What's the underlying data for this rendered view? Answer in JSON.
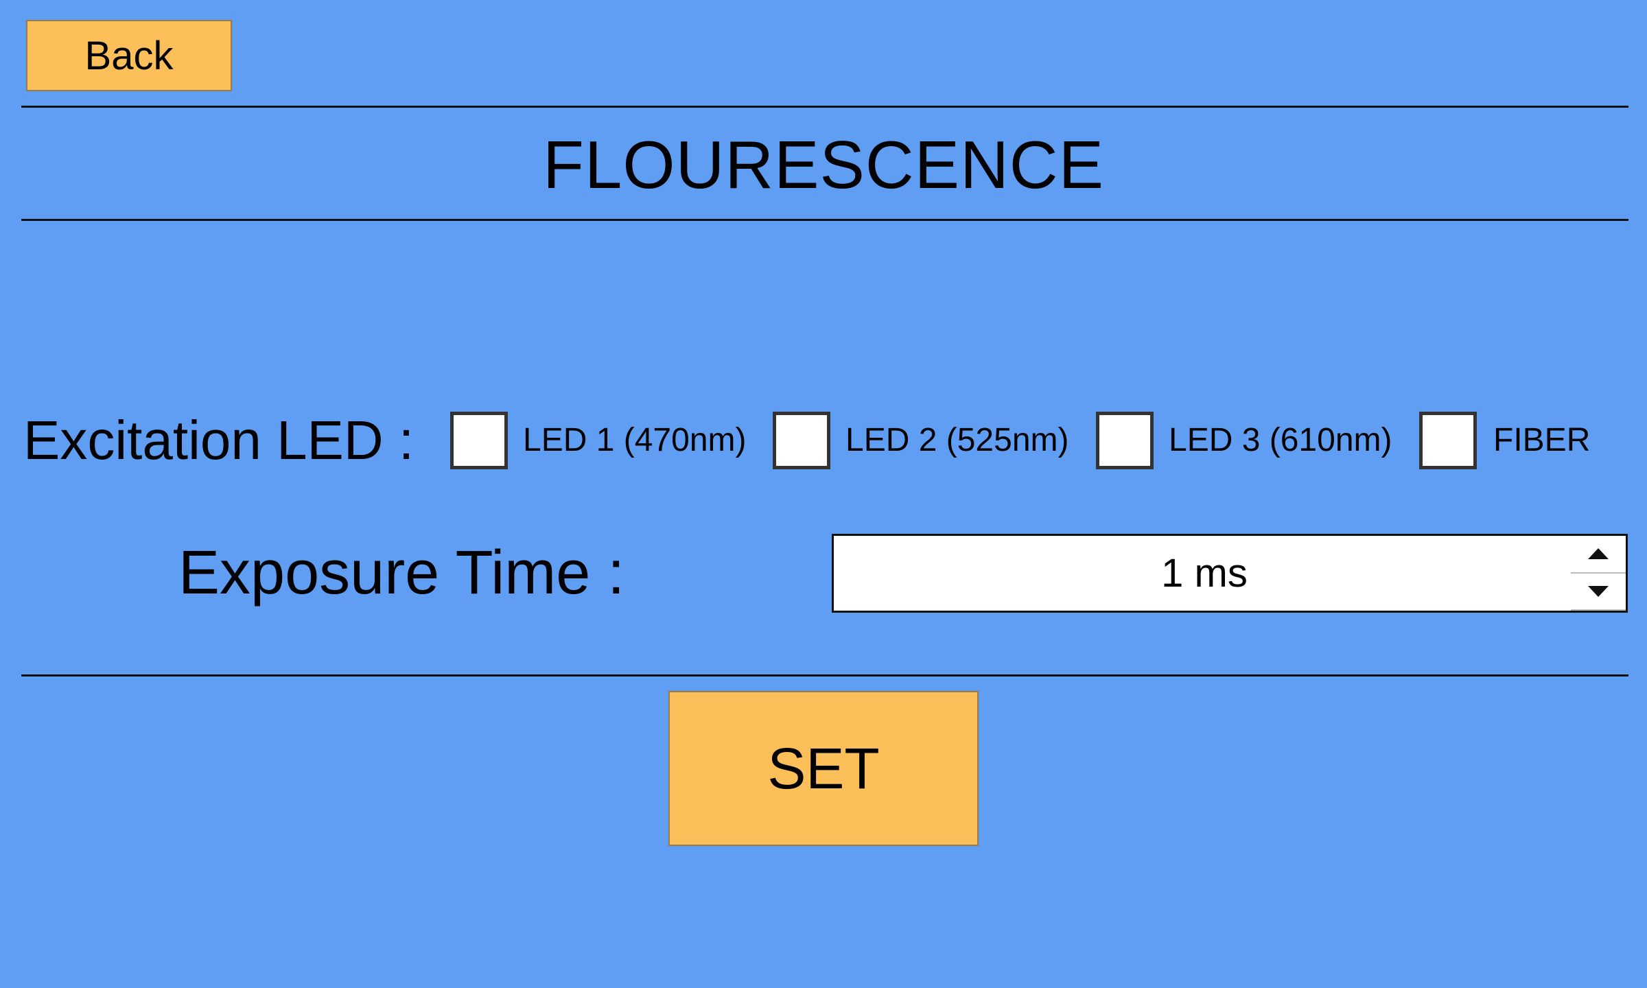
{
  "header": {
    "back_label": "Back",
    "title": "FLOURESCENCE"
  },
  "excitation": {
    "label": "Excitation LED :",
    "options": [
      {
        "label": "LED 1 (470nm)",
        "checked": false
      },
      {
        "label": "LED 2 (525nm)",
        "checked": false
      },
      {
        "label": "LED 3 (610nm)",
        "checked": false
      },
      {
        "label": "FIBER",
        "checked": false
      }
    ]
  },
  "exposure": {
    "label": "Exposure Time :",
    "value": "1 ms"
  },
  "actions": {
    "set_label": "SET"
  },
  "colors": {
    "background": "#5f9ef2",
    "button": "#fcbf59"
  },
  "icons": {
    "spin_up": "spin-up-arrow-icon",
    "spin_down": "spin-down-arrow-icon"
  }
}
